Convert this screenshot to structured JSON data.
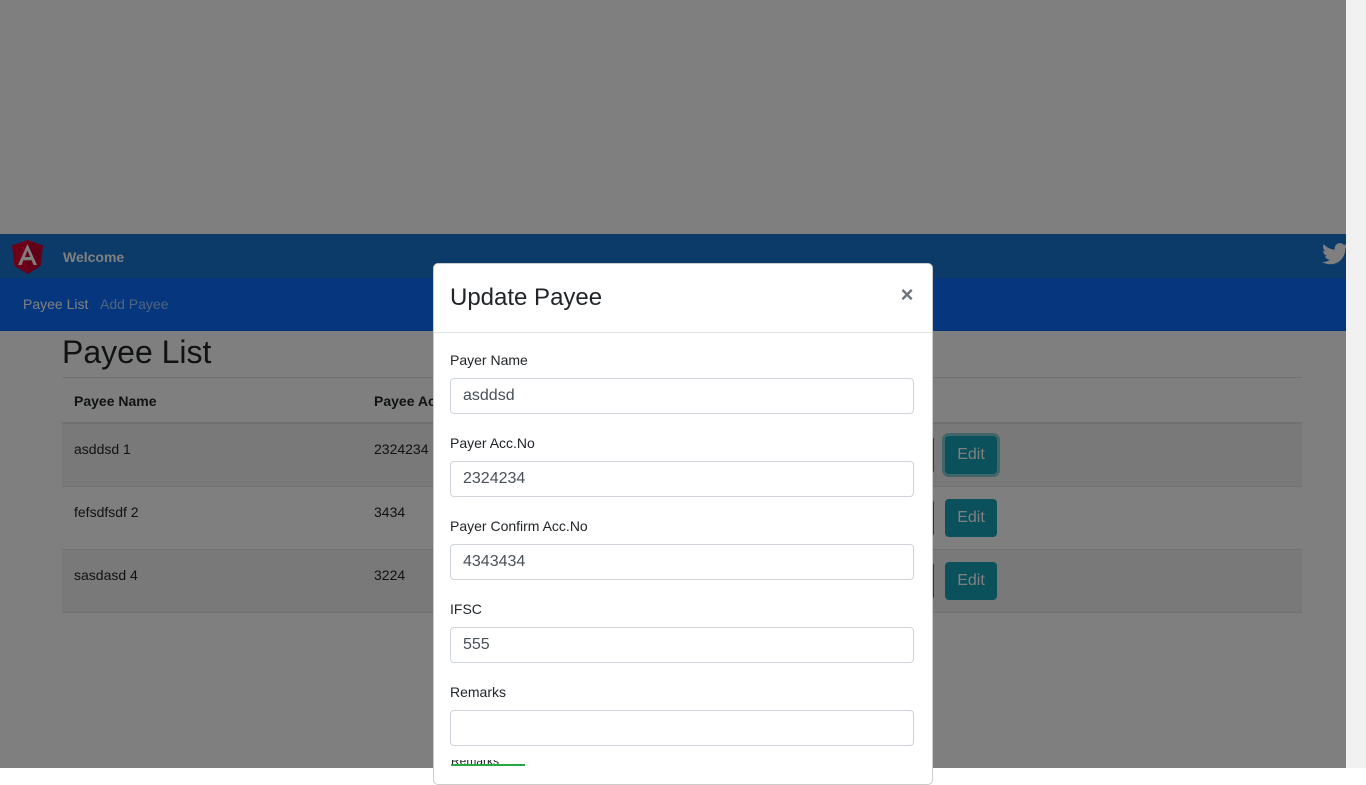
{
  "navbar": {
    "welcome": "Welcome",
    "links": [
      "Payee List",
      "Add Payee"
    ],
    "logo_icon": "angular-logo-icon",
    "social_icon": "twitter-icon"
  },
  "page": {
    "title": "Payee List",
    "table": {
      "headers": [
        "Payee Name",
        "Payee Ac"
      ],
      "rows": [
        {
          "name": "asddsd 1",
          "account": "2324234",
          "edit": "Edit"
        },
        {
          "name": "fefsdfsdf 2",
          "account": "3434",
          "edit": "Edit"
        },
        {
          "name": "sasdasd 4",
          "account": "3224",
          "edit": "Edit"
        }
      ]
    }
  },
  "modal": {
    "title": "Update Payee",
    "close": "×",
    "fields": [
      {
        "label": "Payer Name",
        "value": "asddsd"
      },
      {
        "label": "Payer Acc.No",
        "value": "2324234"
      },
      {
        "label": "Payer Confirm Acc.No",
        "value": "4343434"
      },
      {
        "label": "IFSC",
        "value": "555"
      },
      {
        "label": "Remarks",
        "value": ""
      }
    ],
    "peek_label": "Remarks"
  },
  "colors": {
    "topbar": "#1976d2",
    "subnav": "#0d6efd",
    "edit_button": "#17a2b8",
    "delete_button": "#dc3545",
    "valid_underline": "#28a745"
  }
}
